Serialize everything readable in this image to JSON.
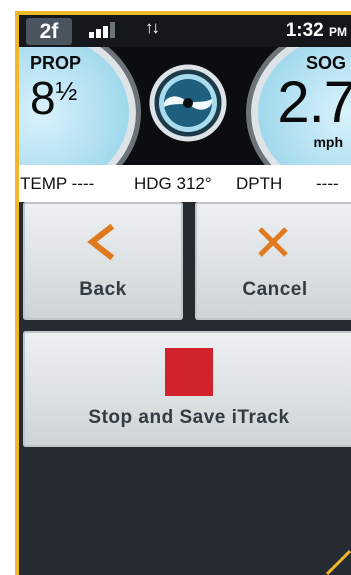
{
  "status_bar": {
    "page_badge": "2f",
    "time": "1:32",
    "time_suffix": "PM",
    "signal_icon": "signal-bars-icon",
    "data_icon": "data-transfer-arrows-icon"
  },
  "gauges": {
    "prop": {
      "label": "PROP",
      "value": "8",
      "fraction": "½"
    },
    "sog": {
      "label": "SOG",
      "value": "2.7",
      "unit": "mph"
    },
    "center_icon": "propeller-icon"
  },
  "info_bar": {
    "temp": "TEMP ----",
    "heading": "HDG 312°",
    "depth_label": "DPTH",
    "depth_value": "----"
  },
  "buttons": {
    "back": {
      "label": "Back",
      "icon": "chevron-left-icon"
    },
    "cancel": {
      "label": "Cancel",
      "icon": "x-icon"
    },
    "stop_save": {
      "label": "Stop and Save iTrack",
      "icon": "stop-square-icon"
    }
  },
  "colors": {
    "frame": "#f1b92a",
    "accent_orange": "#e07a1f",
    "stop_red": "#d0232b",
    "gauge_blue": "#a9dcef"
  }
}
